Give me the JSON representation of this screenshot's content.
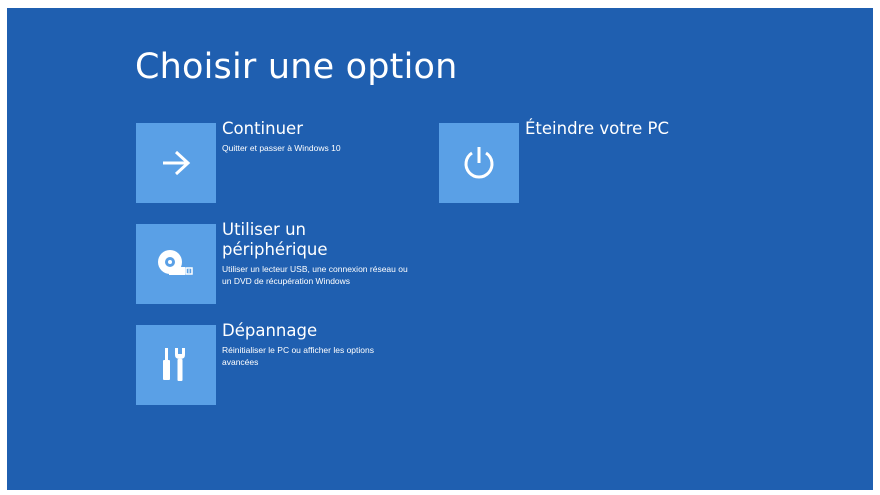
{
  "page": {
    "title": "Choisir une option"
  },
  "options": {
    "continue": {
      "title": "Continuer",
      "description": "Quitter et passer à Windows 10",
      "icon": "arrow-right-icon"
    },
    "device": {
      "title": "Utiliser un périphérique",
      "description": "Utiliser un lecteur USB, une connexion réseau ou un DVD de récupération Windows",
      "icon": "disc-usb-icon"
    },
    "troubleshoot": {
      "title": "Dépannage",
      "description": "Réinitialiser le PC ou afficher les options avancées",
      "icon": "tools-icon"
    },
    "shutdown": {
      "title": "Éteindre votre PC",
      "description": "",
      "icon": "power-icon"
    }
  },
  "colors": {
    "background": "#1f5fb0",
    "tile": "#5aa0e6",
    "text": "#ffffff"
  }
}
